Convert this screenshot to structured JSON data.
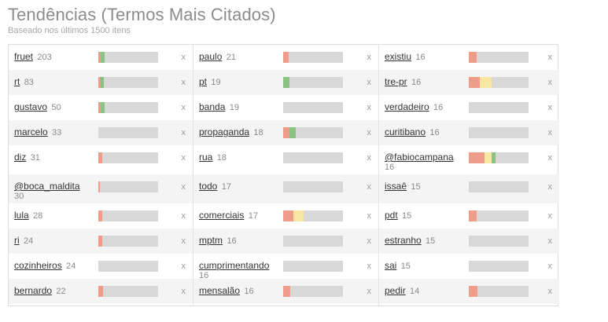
{
  "header": {
    "title": "Tendências (Termos Mais Citados)",
    "subtitle": "Baseado nos últimos 1500 itens"
  },
  "remove_label": "x",
  "colors": {
    "red": "#f09c8a",
    "yellow": "#f7e6a0",
    "green": "#89c283",
    "track": "#d8d8d8"
  },
  "columns": [
    [
      {
        "term": "fruet",
        "count": "203",
        "bar": [
          [
            "red",
            0.04
          ],
          [
            "green",
            0.06
          ]
        ]
      },
      {
        "term": "rt",
        "count": "83",
        "bar": [
          [
            "red",
            0.04
          ],
          [
            "green",
            0.05
          ]
        ]
      },
      {
        "term": "gustavo",
        "count": "50",
        "bar": [
          [
            "red",
            0.04
          ],
          [
            "green",
            0.06
          ]
        ]
      },
      {
        "term": "marcelo",
        "count": "33",
        "bar": []
      },
      {
        "term": "diz",
        "count": "31",
        "bar": [
          [
            "red",
            0.06
          ]
        ]
      },
      {
        "term": "@boca_maldita",
        "count": "30",
        "bar": [
          [
            "red",
            0.03
          ]
        ],
        "wrap": true
      },
      {
        "term": "lula",
        "count": "28",
        "bar": [
          [
            "red",
            0.06
          ]
        ]
      },
      {
        "term": "ri",
        "count": "24",
        "bar": [
          [
            "red",
            0.07
          ]
        ]
      },
      {
        "term": "cozinheiros",
        "count": "24",
        "bar": []
      },
      {
        "term": "bernardo",
        "count": "22",
        "bar": [
          [
            "red",
            0.08
          ]
        ]
      }
    ],
    [
      {
        "term": "paulo",
        "count": "21",
        "bar": [
          [
            "red",
            0.09
          ]
        ]
      },
      {
        "term": "pt",
        "count": "19",
        "bar": [
          [
            "green",
            0.11
          ]
        ]
      },
      {
        "term": "banda",
        "count": "19",
        "bar": []
      },
      {
        "term": "propaganda",
        "count": "18",
        "bar": [
          [
            "red",
            0.11
          ],
          [
            "green",
            0.11
          ]
        ]
      },
      {
        "term": "rua",
        "count": "18",
        "bar": []
      },
      {
        "term": "todo",
        "count": "17",
        "bar": []
      },
      {
        "term": "comerciais",
        "count": "17",
        "bar": [
          [
            "red",
            0.17
          ],
          [
            "yellow",
            0.17
          ]
        ]
      },
      {
        "term": "mptm",
        "count": "16",
        "bar": []
      },
      {
        "term": "cumprimentando",
        "count": "16",
        "bar": [],
        "wrap": true
      },
      {
        "term": "mensalão",
        "count": "16",
        "bar": [
          [
            "red",
            0.12
          ]
        ]
      }
    ],
    [
      {
        "term": "existiu",
        "count": "16",
        "bar": [
          [
            "red",
            0.13
          ]
        ]
      },
      {
        "term": "tre-pr",
        "count": "16",
        "bar": [
          [
            "red",
            0.19
          ],
          [
            "yellow",
            0.2
          ]
        ]
      },
      {
        "term": "verdadeiro",
        "count": "16",
        "bar": []
      },
      {
        "term": "curitibano",
        "count": "16",
        "bar": []
      },
      {
        "term": "@fabiocampana",
        "count": "16",
        "bar": [
          [
            "red",
            0.26
          ],
          [
            "yellow",
            0.12
          ],
          [
            "green",
            0.06
          ]
        ],
        "wrap": true
      },
      {
        "term": "issaê",
        "count": "15",
        "bar": []
      },
      {
        "term": "pdt",
        "count": "15",
        "bar": [
          [
            "red",
            0.13
          ]
        ]
      },
      {
        "term": "estranho",
        "count": "15",
        "bar": []
      },
      {
        "term": "sai",
        "count": "15",
        "bar": []
      },
      {
        "term": "pedir",
        "count": "14",
        "bar": [
          [
            "red",
            0.15
          ]
        ]
      }
    ]
  ]
}
